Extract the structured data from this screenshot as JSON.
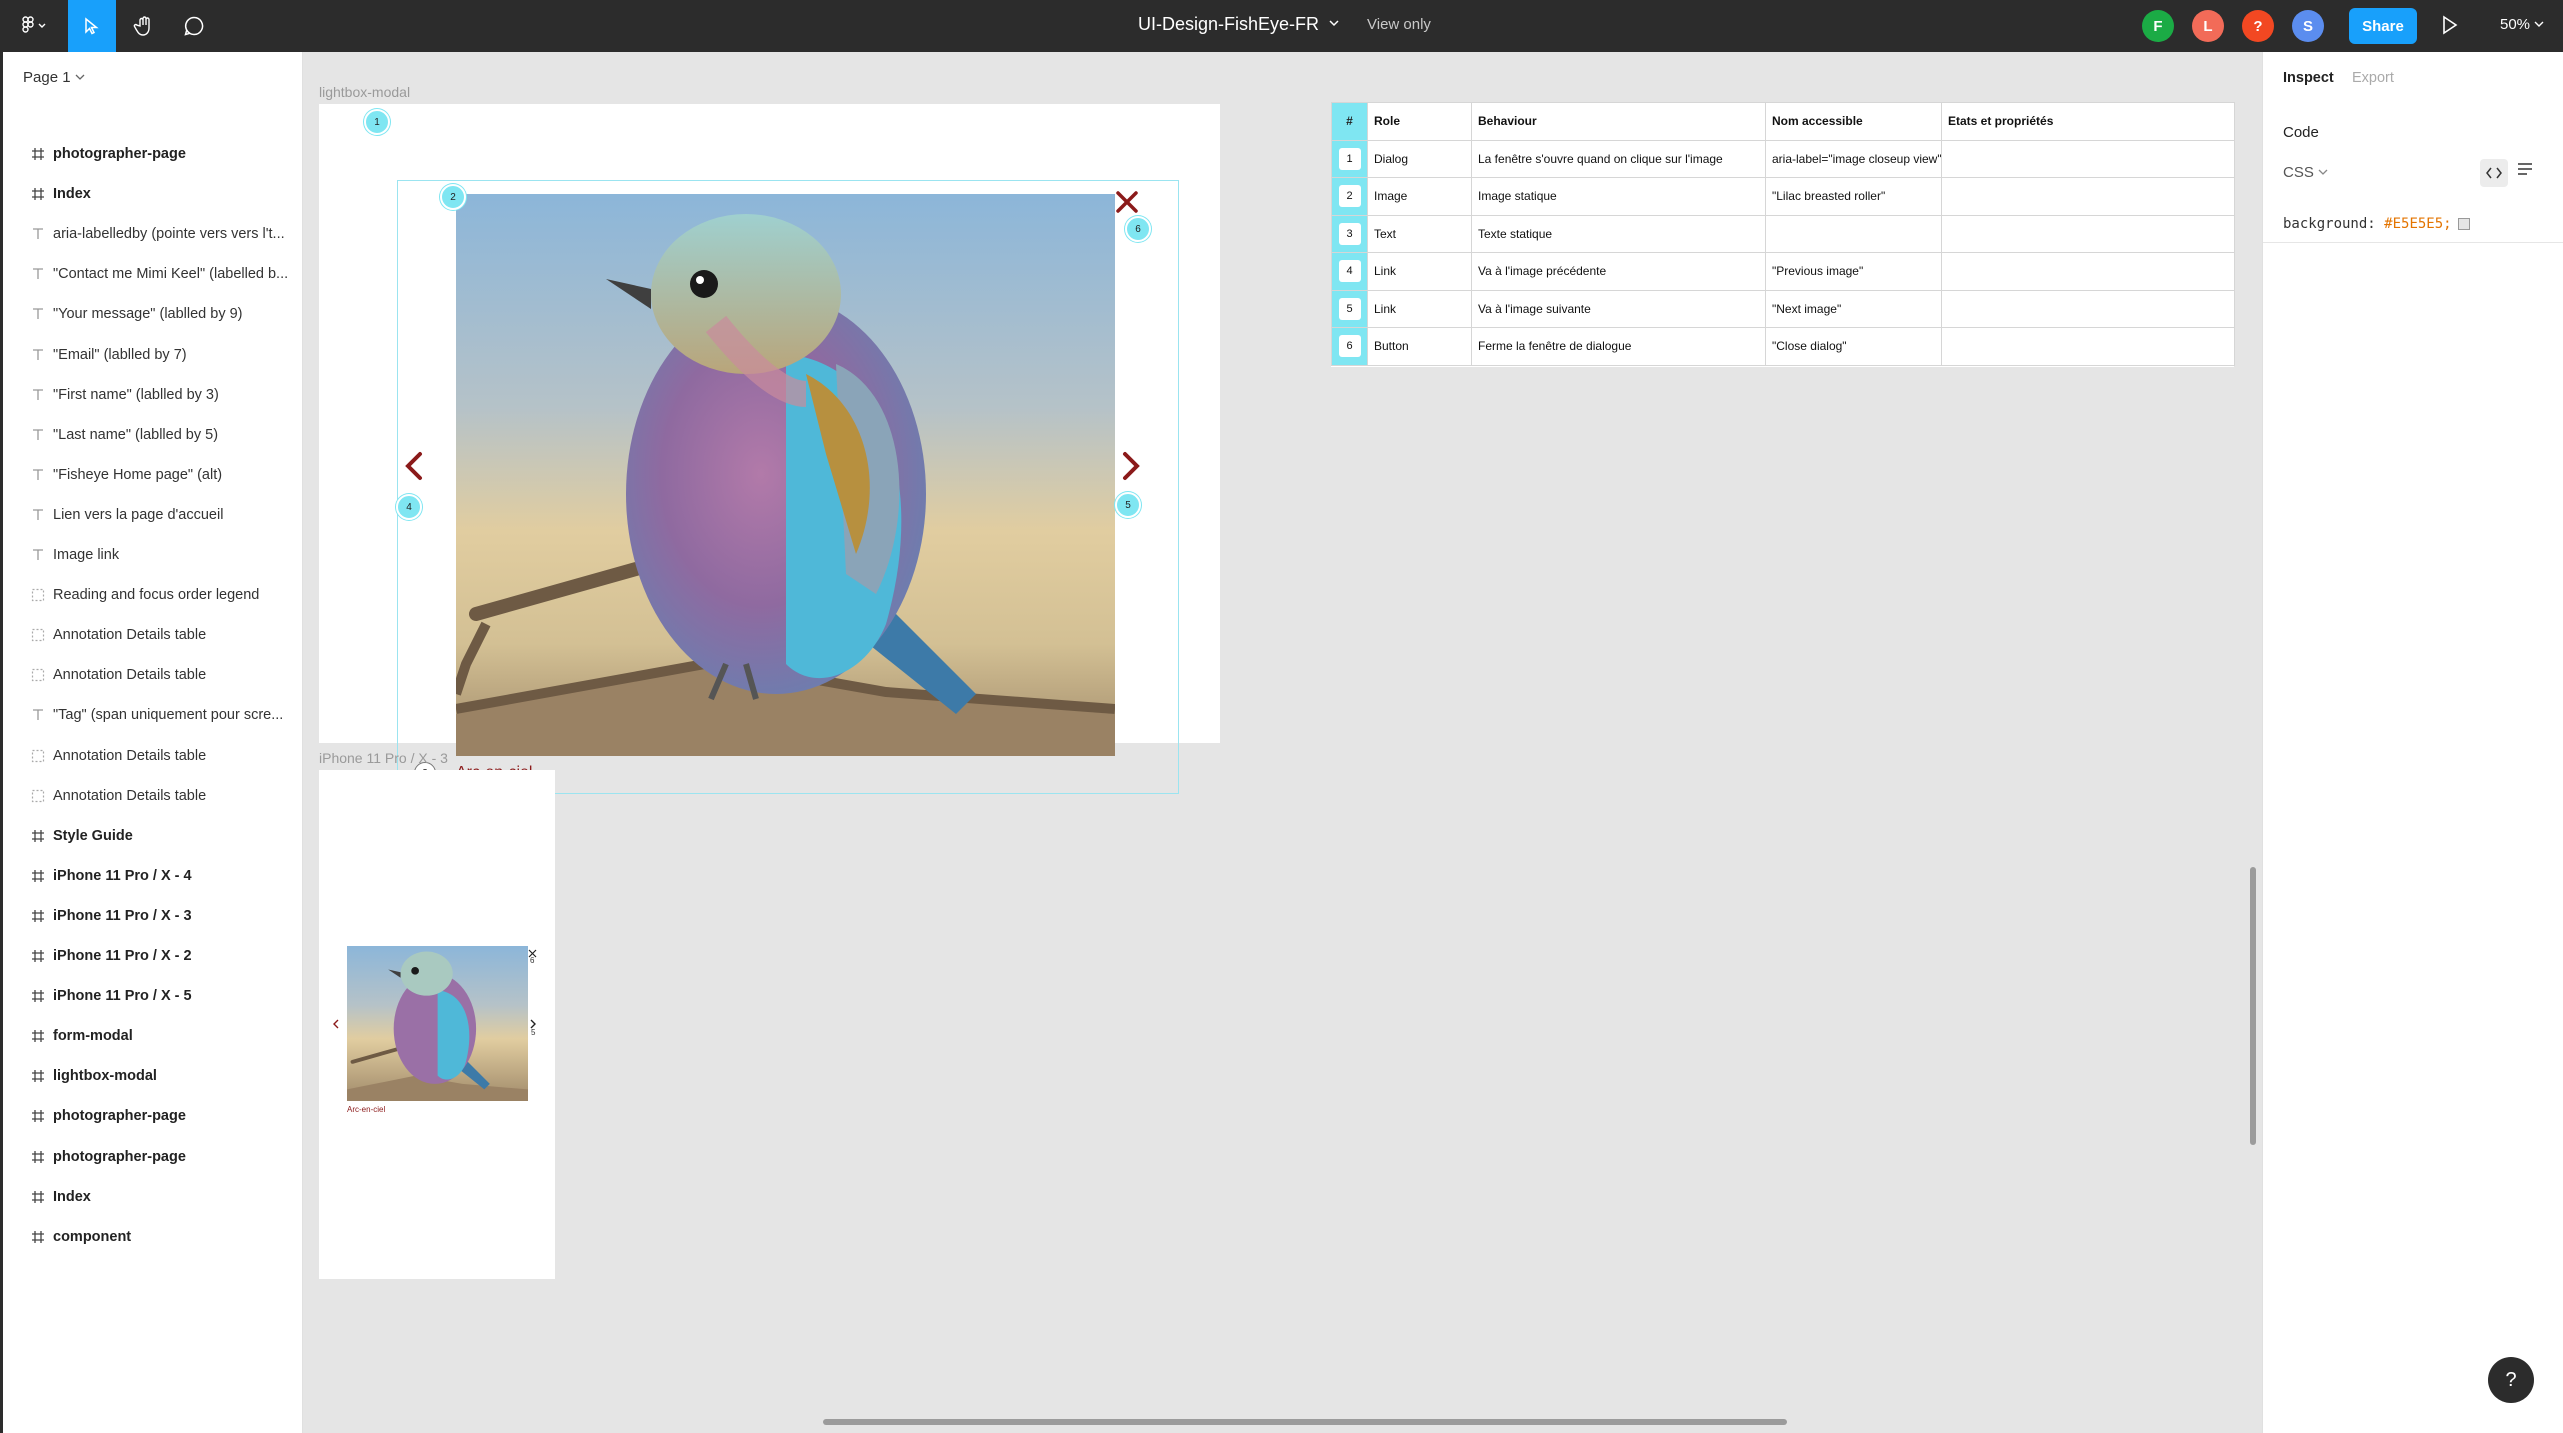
{
  "topbar": {
    "file_title": "UI-Design-FishEye-FR",
    "view_mode": "View only",
    "avatars": [
      {
        "letter": "F",
        "color": "#1bab45"
      },
      {
        "letter": "L",
        "color": "#f26b58"
      },
      {
        "letter": "?",
        "color": "#f24822"
      },
      {
        "letter": "S",
        "color": "#5b8def"
      }
    ],
    "share_label": "Share",
    "zoom": "50%",
    "accent": "#18a0fb"
  },
  "left_panel": {
    "page_selector": "Page 1",
    "layers": [
      {
        "type": "frame",
        "label": "photographer-page"
      },
      {
        "type": "frame",
        "label": "Index"
      },
      {
        "type": "text",
        "label": "aria-labelledby (pointe vers vers l't..."
      },
      {
        "type": "text",
        "label": "\"Contact me Mimi Keel\" (labelled b..."
      },
      {
        "type": "text",
        "label": "\"Your message\" (lablled by 9)"
      },
      {
        "type": "text",
        "label": "\"Email\" (lablled by 7)"
      },
      {
        "type": "text",
        "label": "\"First name\" (lablled by 3)"
      },
      {
        "type": "text",
        "label": "\"Last name\" (lablled by 5)"
      },
      {
        "type": "text",
        "label": "\"Fisheye Home page\" (alt)"
      },
      {
        "type": "text",
        "label": "Lien vers la page d'accueil"
      },
      {
        "type": "text",
        "label": "Image link"
      },
      {
        "type": "component",
        "label": "Reading and focus order legend"
      },
      {
        "type": "component",
        "label": "Annotation Details table"
      },
      {
        "type": "component",
        "label": "Annotation Details table"
      },
      {
        "type": "text",
        "label": "\"Tag\" (span uniquement pour scre..."
      },
      {
        "type": "component",
        "label": "Annotation Details table"
      },
      {
        "type": "component",
        "label": "Annotation Details table"
      },
      {
        "type": "frame",
        "label": "Style Guide"
      },
      {
        "type": "frame",
        "label": "iPhone 11 Pro / X - 4"
      },
      {
        "type": "frame",
        "label": "iPhone 11 Pro / X - 3"
      },
      {
        "type": "frame",
        "label": "iPhone 11 Pro / X - 2"
      },
      {
        "type": "frame",
        "label": "iPhone 11 Pro / X - 5"
      },
      {
        "type": "frame",
        "label": "form-modal"
      },
      {
        "type": "frame",
        "label": "lightbox-modal"
      },
      {
        "type": "frame",
        "label": "photographer-page"
      },
      {
        "type": "frame",
        "label": "photographer-page"
      },
      {
        "type": "frame",
        "label": "Index"
      },
      {
        "type": "frame",
        "label": "component"
      }
    ]
  },
  "canvas": {
    "lightbox_label": "lightbox-modal",
    "iphone_label": "iPhone 11 Pro / X - 3",
    "caption": "Arc-en-ciel",
    "mini_caption": "Arc-en-ciel",
    "annotations": {
      "dialog": "1",
      "image": "2",
      "text": "3",
      "prev": "4",
      "next": "5",
      "close": "6"
    },
    "accent_red": "#8b1a1a",
    "annotation_color": "#7fe6f2",
    "table": {
      "headers": [
        "#",
        "Role",
        "Behaviour",
        "Nom accessible",
        "Etats et propriétés"
      ],
      "rows": [
        [
          "1",
          "Dialog",
          "La fenêtre s'ouvre quand on clique sur l'image",
          "aria-label=\"image closeup view\"",
          ""
        ],
        [
          "2",
          "Image",
          "Image statique",
          "\"Lilac breasted roller\"",
          ""
        ],
        [
          "3",
          "Text",
          "Texte statique",
          "",
          ""
        ],
        [
          "4",
          "Link",
          "Va à l'image précédente",
          "\"Previous image\"",
          ""
        ],
        [
          "5",
          "Link",
          "Va à l'image suivante",
          "\"Next image\"",
          ""
        ],
        [
          "6",
          "Button",
          "Ferme la fenêtre de dialogue",
          "\"Close dialog\"",
          ""
        ]
      ]
    }
  },
  "right_panel": {
    "tabs": [
      "Inspect",
      "Export"
    ],
    "code_title": "Code",
    "language": "CSS",
    "code_property": "background:",
    "code_value": "#E5E5E5;"
  },
  "help": "?"
}
